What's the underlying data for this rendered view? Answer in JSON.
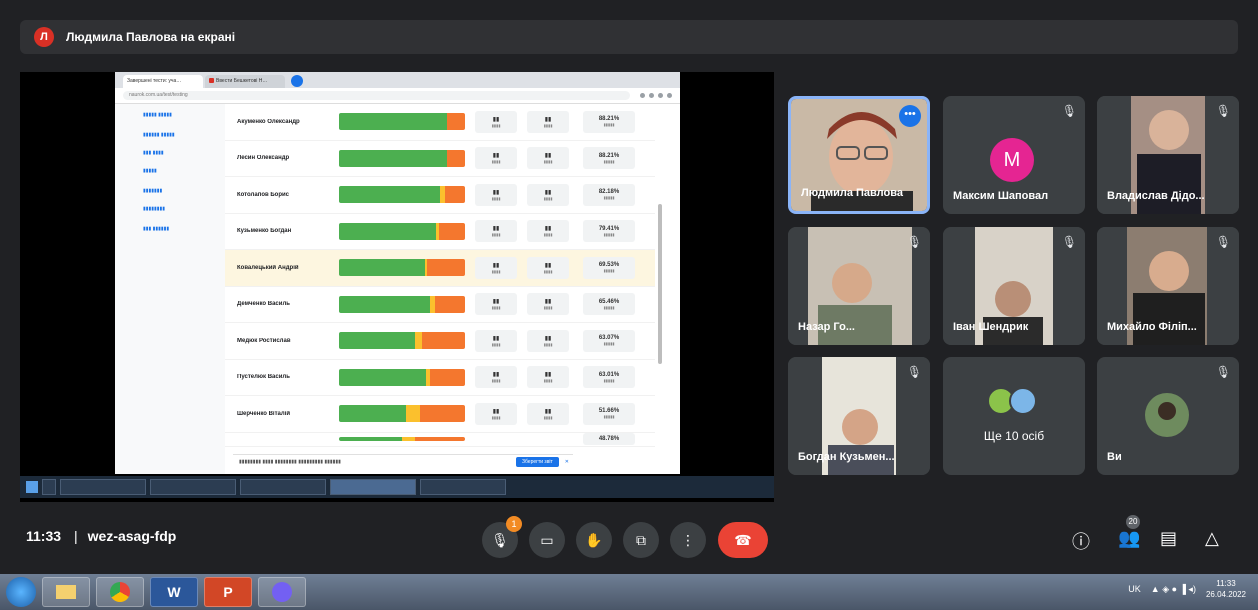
{
  "presenter": {
    "initial": "Л",
    "text": "Людмила Павлова на екрані"
  },
  "browser": {
    "tab1": "Завершені тести: уча…",
    "tab2": "Ввести Бешкетові Н…",
    "address": "naurok.com.ua/test/testing"
  },
  "students": [
    {
      "name": "Акуменко Олександр",
      "pct": "88.21%"
    },
    {
      "name": "Лесин Олександр",
      "pct": "88.21%"
    },
    {
      "name": "Котолапов Борис",
      "pct": "82.18%"
    },
    {
      "name": "Кузьменко Богдан",
      "pct": "79.41%"
    },
    {
      "name": "Ковалецький Андрій",
      "pct": "69.53%"
    },
    {
      "name": "Демченко Василь",
      "pct": "65.46%"
    },
    {
      "name": "Медюк Ростислав",
      "pct": "63.07%"
    },
    {
      "name": "Пустелюк Василь",
      "pct": "63.01%"
    },
    {
      "name": "Шерченко Віталій",
      "pct": "51.66%"
    }
  ],
  "student_bars": [
    {
      "green": 0.86,
      "yellow": 0.0,
      "red": 0.14
    },
    {
      "green": 0.86,
      "yellow": 0.0,
      "red": 0.14
    },
    {
      "green": 0.8,
      "yellow": 0.04,
      "red": 0.16
    },
    {
      "green": 0.77,
      "yellow": 0.02,
      "red": 0.21
    },
    {
      "green": 0.68,
      "yellow": 0.02,
      "red": 0.3
    },
    {
      "green": 0.72,
      "yellow": 0.04,
      "red": 0.24
    },
    {
      "green": 0.6,
      "yellow": 0.06,
      "red": 0.34
    },
    {
      "green": 0.69,
      "yellow": 0.03,
      "red": 0.28
    },
    {
      "green": 0.53,
      "yellow": 0.11,
      "red": 0.36
    }
  ],
  "extra_pct": "48.78%",
  "notice": {
    "button": "Зберегти звіт"
  },
  "participants": [
    {
      "name": "Людмила Павлова"
    },
    {
      "name": "Максим Шаповал",
      "initial": "M"
    },
    {
      "name": "Владислав Дідо..."
    },
    {
      "name": "Назар Го..."
    },
    {
      "name": "Іван Шендрик"
    },
    {
      "name": "Михайло Філіп..."
    },
    {
      "name": "Богдан Кузьмен..."
    },
    {
      "name": "Ще 10 осіб"
    },
    {
      "name": "Ви"
    }
  ],
  "meeting": {
    "time": "11:33",
    "separator": "|",
    "code": "wez-asag-fdp",
    "people_count": "20",
    "raise_badge": "1"
  },
  "taskbar": {
    "apps": [
      "W",
      "P"
    ],
    "lang": "UK",
    "clock_time": "11:33",
    "clock_date": "26.04.2022"
  },
  "icons": [
    "mic-off-icon",
    "camera-icon",
    "hand-icon",
    "present-icon",
    "more-icon",
    "end-call-icon",
    "info-icon",
    "people-icon",
    "chat-icon",
    "activities-icon"
  ],
  "colors": {
    "end_call": "#ea4335",
    "accent": "#1a73e8"
  }
}
